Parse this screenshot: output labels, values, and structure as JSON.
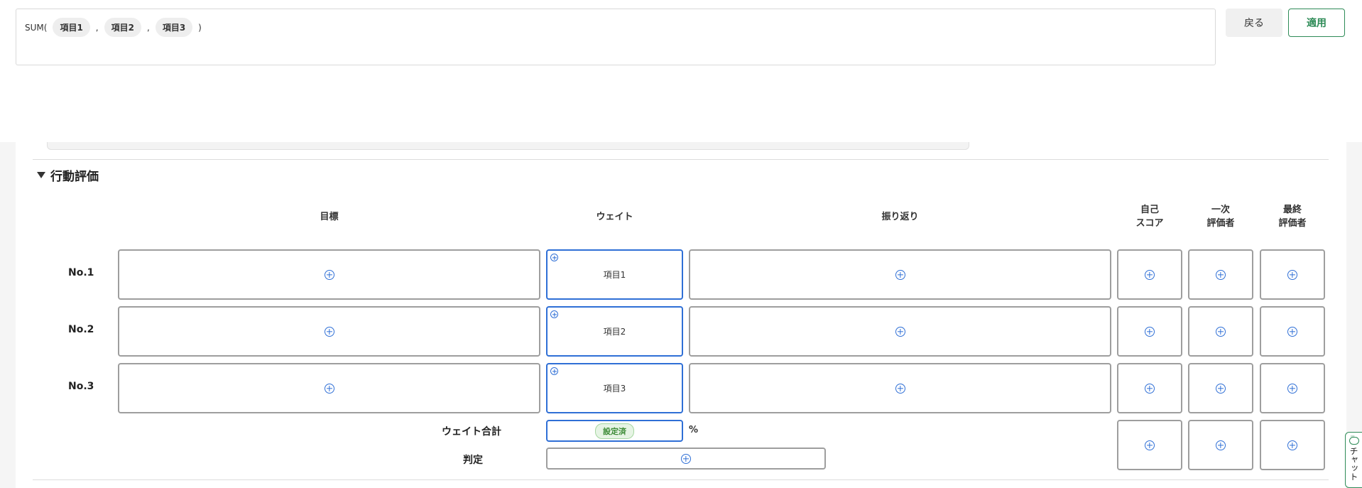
{
  "formula": {
    "function": "SUM(",
    "items": [
      "項目1",
      "項目2",
      "項目3"
    ],
    "separator": ",",
    "close": ")"
  },
  "actions": {
    "back_label": "戻る",
    "apply_label": "適用"
  },
  "section": {
    "title": "行動評価"
  },
  "columns": {
    "goal": "目標",
    "weight": "ウェイト",
    "reflection": "振り返り",
    "self_score": [
      "自己",
      "スコア"
    ],
    "first_evaluator": [
      "一次",
      "評価者"
    ],
    "final_evaluator": [
      "最終",
      "評価者"
    ]
  },
  "rows": [
    {
      "label": "No.1",
      "weight_item": "項目1"
    },
    {
      "label": "No.2",
      "weight_item": "項目2"
    },
    {
      "label": "No.3",
      "weight_item": "項目3"
    }
  ],
  "summary": {
    "weight_total_label": "ウェイト合計",
    "weight_total_badge": "設定済",
    "percent": "%",
    "judgement_label": "判定"
  },
  "chat": {
    "label": "チャット"
  },
  "colors": {
    "accent_blue": "#2f6fd6",
    "accent_green": "#2e8b57",
    "badge_green": "#3b8a35"
  },
  "icons": [
    "add-circle-icon",
    "caret-down-icon",
    "chat-icon"
  ]
}
